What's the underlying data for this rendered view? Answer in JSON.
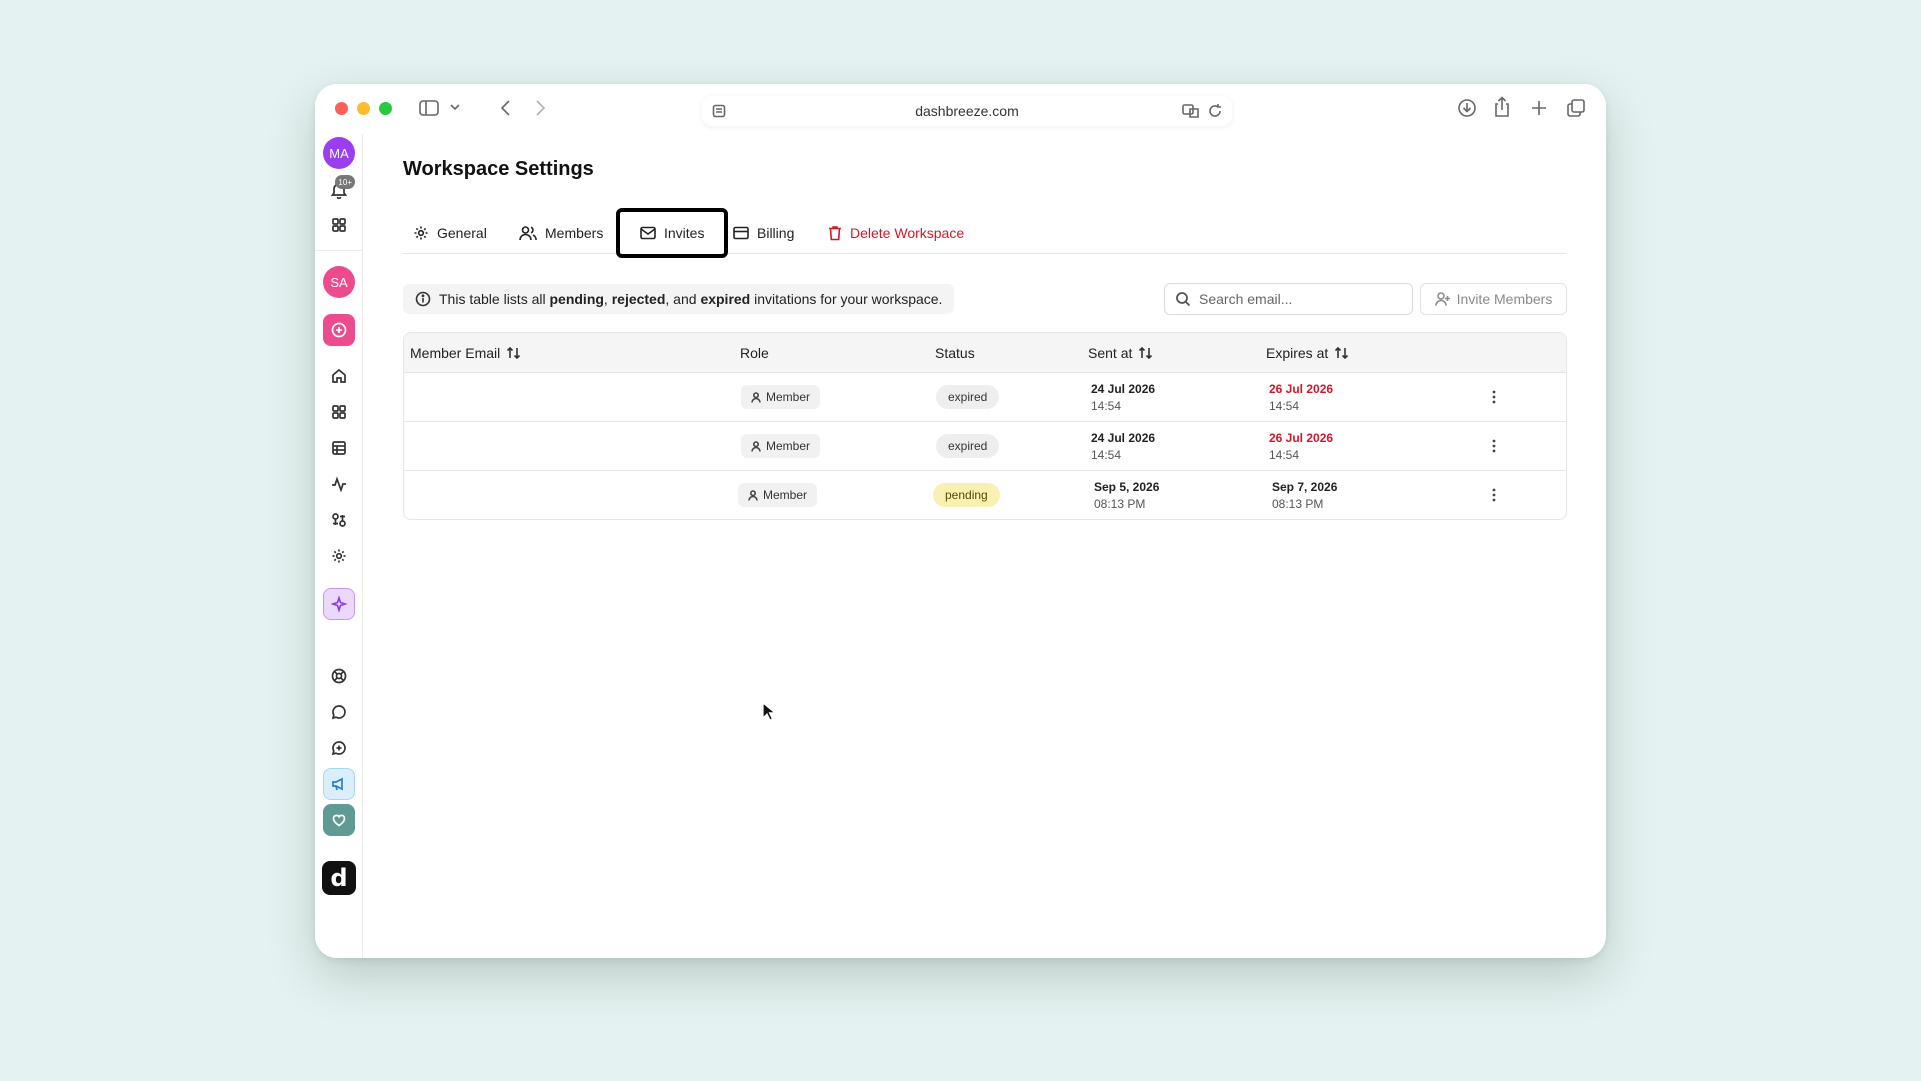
{
  "browser": {
    "url": "dashbreeze.com"
  },
  "rail": {
    "top_avatar": {
      "initials": "MA",
      "color": "#9b3ef0"
    },
    "notification_badge": "10+",
    "second_avatar": {
      "initials": "SA",
      "color": "#ec4c8e"
    },
    "items": [
      "home-icon",
      "dashboard-icon",
      "table-icon",
      "activity-icon",
      "integrations-icon",
      "gear-icon"
    ],
    "ai_icon": "sparkles-icon",
    "bottom_items": [
      "help-icon",
      "chat-icon",
      "add-circle-icon",
      "megaphone-icon",
      "heart-icon"
    ],
    "logo_letter": "d"
  },
  "page": {
    "title": "Workspace Settings"
  },
  "tabs": [
    {
      "label": "General",
      "icon": "gear-icon"
    },
    {
      "label": "Members",
      "icon": "users-icon"
    },
    {
      "label": "Invites",
      "icon": "mail-icon",
      "active": true
    },
    {
      "label": "Billing",
      "icon": "credit-card-icon"
    },
    {
      "label": "Delete Workspace",
      "icon": "trash-icon",
      "danger": true
    }
  ],
  "info": {
    "prefix": "This table lists all ",
    "b1": "pending",
    "sep1": ", ",
    "b2": "rejected",
    "sep2": ", and ",
    "b3": "expired",
    "suffix": " invitations for your workspace."
  },
  "search": {
    "placeholder": "Search email..."
  },
  "invite_button": {
    "label": "Invite Members"
  },
  "table": {
    "headers": {
      "email": "Member Email",
      "role": "Role",
      "status": "Status",
      "sent": "Sent at",
      "expires": "Expires at"
    },
    "rows": [
      {
        "email": "",
        "role": "Member",
        "status": "expired",
        "sent_date": "24 Jul 2026",
        "sent_time": "14:54",
        "exp_date": "26 Jul 2026",
        "exp_time": "14:54"
      },
      {
        "email": "",
        "role": "Member",
        "status": "expired",
        "sent_date": "24 Jul 2026",
        "sent_time": "14:54",
        "exp_date": "26 Jul 2026",
        "exp_time": "14:54"
      },
      {
        "email": "",
        "role": "Member",
        "status": "pending",
        "sent_date": "Sep 5, 2026",
        "sent_time": "08:13 PM",
        "exp_date": "Sep 7, 2026",
        "exp_time": "08:13 PM"
      }
    ]
  },
  "colors": {
    "background": "#e4f3f1",
    "danger": "#d0182b",
    "pending_bg": "#fbf0b3"
  }
}
